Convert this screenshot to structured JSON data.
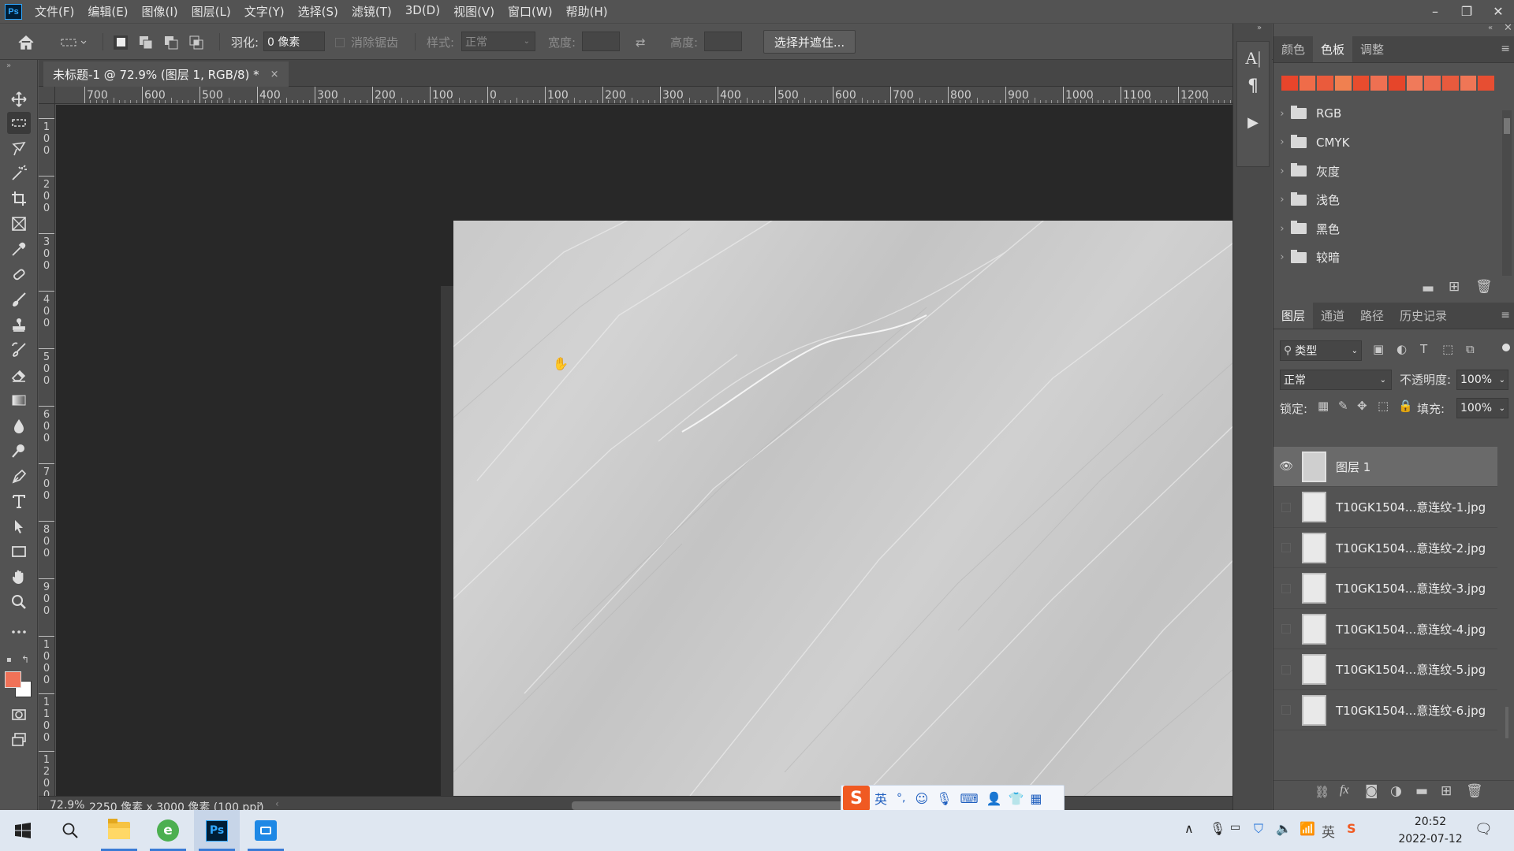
{
  "app": {
    "logo": "Ps"
  },
  "menu": [
    "文件(F)",
    "编辑(E)",
    "图像(I)",
    "图层(L)",
    "文字(Y)",
    "选择(S)",
    "滤镜(T)",
    "3D(D)",
    "视图(V)",
    "窗口(W)",
    "帮助(H)"
  ],
  "window_controls": {
    "minimize": "–",
    "restore": "❐",
    "close": "✕"
  },
  "options": {
    "feather_label": "羽化:",
    "feather_value": "0 像素",
    "antialias_label": "消除锯齿",
    "style_label": "样式:",
    "style_value": "正常",
    "width_label": "宽度:",
    "height_label": "高度:",
    "select_mask_button": "选择并遮住..."
  },
  "document": {
    "tab_title": "未标题-1 @ 72.9% (图层 1, RGB/8) *",
    "close_icon": "×",
    "zoom": "72.9%",
    "size_info": "2250 像素 x 3000 像素 (100 ppi)",
    "status_arrow": "›"
  },
  "ruler_h": [
    "700",
    "600",
    "500",
    "400",
    "300",
    "200",
    "100",
    "0",
    "100",
    "200",
    "300",
    "400",
    "500",
    "600",
    "700",
    "800",
    "900",
    "1000",
    "1100",
    "1200"
  ],
  "ruler_v": [
    "100",
    "200",
    "300",
    "400",
    "500",
    "600",
    "700",
    "800",
    "900",
    "1000",
    "1100",
    "1200"
  ],
  "swatch_panel": {
    "tabs": [
      "颜色",
      "色板",
      "调整"
    ],
    "active_tab": "色板",
    "swatch_colors": [
      "#e8452b",
      "#ef6c49",
      "#ea5b3c",
      "#f08050",
      "#e84c2e",
      "#ee7052",
      "#e6452a",
      "#f07a5a",
      "#ec6a4e",
      "#e85a3d",
      "#ef7656",
      "#e74e32"
    ],
    "folders": [
      "RGB",
      "CMYK",
      "灰度",
      "浅色",
      "黑色",
      "较暗"
    ]
  },
  "layers_panel": {
    "tabs": [
      "图层",
      "通道",
      "路径",
      "历史记录"
    ],
    "active_tab": "图层",
    "filter_label": "类型",
    "blend_mode": "正常",
    "opacity_label": "不透明度:",
    "opacity_value": "100%",
    "lock_label": "锁定:",
    "fill_label": "填充:",
    "fill_value": "100%",
    "layers": [
      {
        "name": "图层 1",
        "visible": true,
        "selected": true
      },
      {
        "name": "T10GK1504...意连纹-1.jpg",
        "visible": false,
        "selected": false
      },
      {
        "name": "T10GK1504...意连纹-2.jpg",
        "visible": false,
        "selected": false
      },
      {
        "name": "T10GK1504...意连纹-3.jpg",
        "visible": false,
        "selected": false
      },
      {
        "name": "T10GK1504...意连纹-4.jpg",
        "visible": false,
        "selected": false
      },
      {
        "name": "T10GK1504...意连纹-5.jpg",
        "visible": false,
        "selected": false
      },
      {
        "name": "T10GK1504...意连纹-6.jpg",
        "visible": false,
        "selected": false
      }
    ]
  },
  "ime": {
    "mode": "英"
  },
  "taskbar": {
    "time": "20:52",
    "date": "2022-07-12"
  },
  "colors": {
    "foreground": "#f07258",
    "background": "#ffffff"
  }
}
